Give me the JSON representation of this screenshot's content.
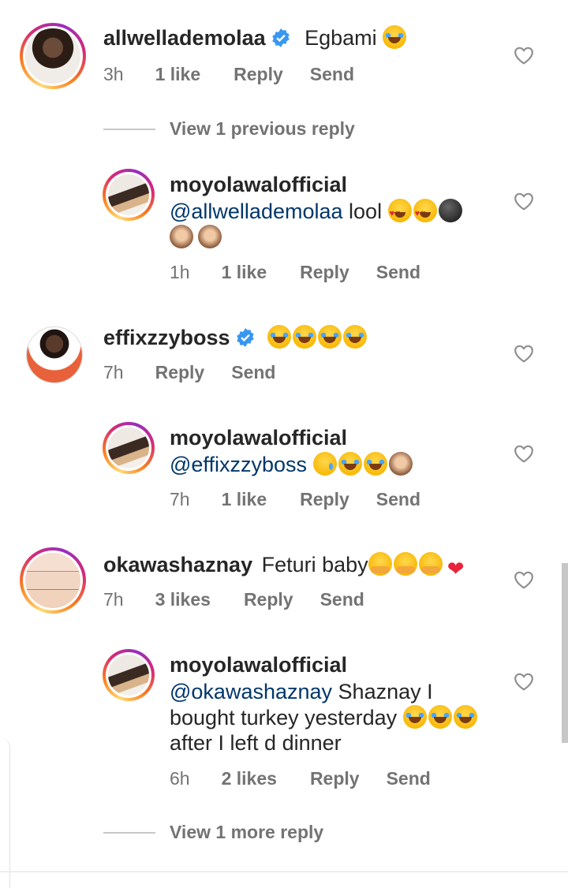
{
  "comments": [
    {
      "username": "allwellademolaa",
      "verified": true,
      "text": "Egbami",
      "emojis": [
        "laugh"
      ],
      "time": "3h",
      "likes": "1 like",
      "reply_label": "Reply",
      "send_label": "Send",
      "view_replies": "View 1 previous reply"
    },
    {
      "username": "moyolawalofficial",
      "mention": "@allwellademolaa",
      "text": "lool",
      "emojis": [
        "heart-eyes",
        "heart-eyes",
        "dark-moon",
        "see-no-evil-monkey",
        "see-no-evil-monkey"
      ],
      "time": "1h",
      "likes": "1 like",
      "reply_label": "Reply",
      "send_label": "Send"
    },
    {
      "username": "effixzzyboss",
      "verified": true,
      "text": "",
      "emojis": [
        "laugh",
        "laugh",
        "laugh",
        "laugh"
      ],
      "time": "7h",
      "reply_label": "Reply",
      "send_label": "Send"
    },
    {
      "username": "moyolawalofficial",
      "mention": "@effixzzyboss",
      "emojis": [
        "crying",
        "laugh",
        "laugh",
        "see-no-evil-monkey"
      ],
      "time": "7h",
      "likes": "1 like",
      "reply_label": "Reply",
      "send_label": "Send"
    },
    {
      "username": "okawashaznay",
      "text": "Feturi baby",
      "emojis": [
        "hugging",
        "hugging",
        "hugging",
        "two-hearts"
      ],
      "time": "7h",
      "likes": "3 likes",
      "reply_label": "Reply",
      "send_label": "Send"
    },
    {
      "username": "moyolawalofficial",
      "mention": "@okawashaznay",
      "text_line1": "Shaznay I",
      "text_line2": "bought turkey yesterday",
      "text_line3": "after I left d dinner",
      "emojis": [
        "laugh",
        "laugh",
        "laugh"
      ],
      "time": "6h",
      "likes": "2 likes",
      "reply_label": "Reply",
      "send_label": "Send",
      "view_replies": "View 1 more reply"
    }
  ],
  "colors": {
    "text": "#262626",
    "secondary": "#737373",
    "mention": "#00376b",
    "verified": "#3897f0"
  }
}
